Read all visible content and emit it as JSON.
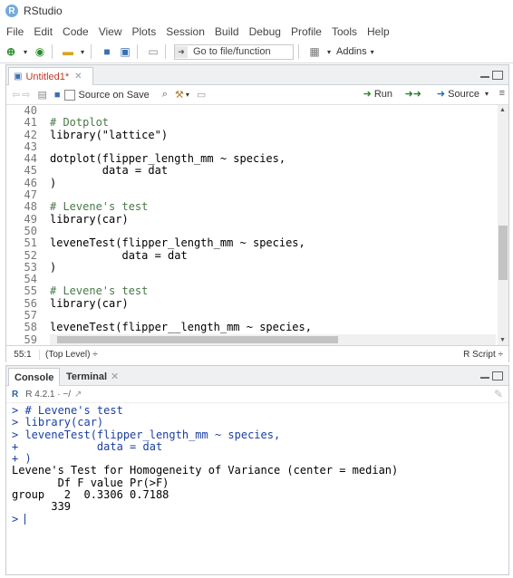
{
  "window": {
    "title": "RStudio",
    "logo": "R"
  },
  "menu": [
    "File",
    "Edit",
    "Code",
    "View",
    "Plots",
    "Session",
    "Build",
    "Debug",
    "Profile",
    "Tools",
    "Help"
  ],
  "toolbar": {
    "goto_placeholder": "Go to file/function",
    "addins": "Addins"
  },
  "editor": {
    "tab_label": "Untitled1*",
    "source_on_save": "Source on Save",
    "run_label": "Run",
    "source_label": "Source",
    "lines": [
      {
        "n": "40",
        "t": ""
      },
      {
        "n": "41",
        "t": "# Dotplot"
      },
      {
        "n": "42",
        "t": "library(\"lattice\")"
      },
      {
        "n": "43",
        "t": ""
      },
      {
        "n": "44",
        "t": "dotplot(flipper_length_mm ~ species,"
      },
      {
        "n": "45",
        "t": "        data = dat"
      },
      {
        "n": "46",
        "t": ")"
      },
      {
        "n": "47",
        "t": ""
      },
      {
        "n": "48",
        "t": "# Levene's test"
      },
      {
        "n": "49",
        "t": "library(car)"
      },
      {
        "n": "50",
        "t": ""
      },
      {
        "n": "51",
        "t": "leveneTest(flipper_length_mm ~ species,"
      },
      {
        "n": "52",
        "t": "           data = dat"
      },
      {
        "n": "53",
        "t": ")"
      },
      {
        "n": "54",
        "t": ""
      },
      {
        "n": "55",
        "t": "# Levene's test"
      },
      {
        "n": "56",
        "t": "library(car)"
      },
      {
        "n": "57",
        "t": ""
      },
      {
        "n": "58",
        "t": "leveneTest(flipper__length_mm ~ species,"
      },
      {
        "n": "59",
        "t": ""
      }
    ],
    "status_pos": "55:1",
    "status_level": "(Top Level) ÷",
    "status_type": "R Script ÷"
  },
  "console": {
    "tab_console": "Console",
    "tab_terminal": "Terminal",
    "r_version": "R 4.2.1 · ~/",
    "output": [
      {
        "t": "> # Levene's test",
        "cmd": true
      },
      {
        "t": "> library(car)",
        "cmd": true
      },
      {
        "t": "> leveneTest(flipper_length_mm ~ species,",
        "cmd": true
      },
      {
        "t": "+            data = dat",
        "cmd": true
      },
      {
        "t": "+ )",
        "cmd": true
      },
      {
        "t": "Levene's Test for Homogeneity of Variance (center = median)",
        "cmd": false
      },
      {
        "t": "       Df F value Pr(>F)",
        "cmd": false
      },
      {
        "t": "group   2  0.3306 0.7188",
        "cmd": false
      },
      {
        "t": "      339",
        "cmd": false
      }
    ],
    "prompt": "> "
  }
}
